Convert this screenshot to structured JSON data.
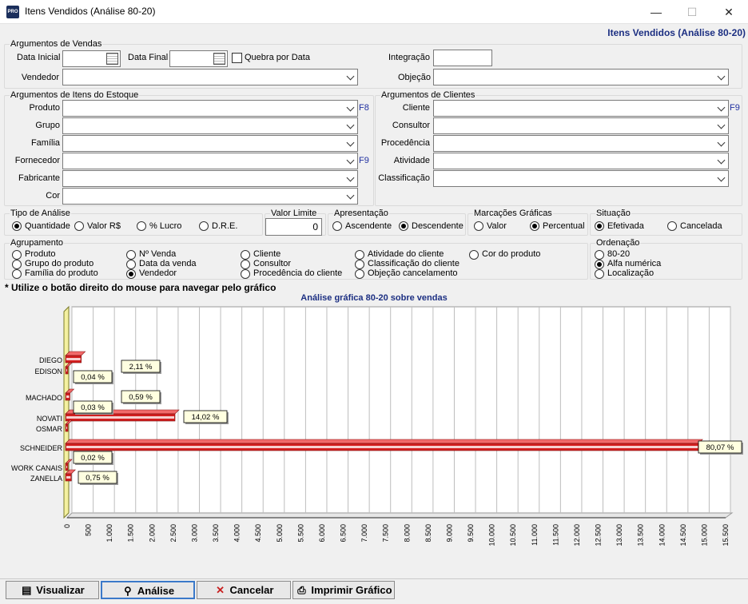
{
  "window": {
    "title": "Itens Vendidos (Análise 80-20)",
    "icon_text": "PRO",
    "minimize_glyph": "—",
    "maximize_glyph": "☐",
    "close_glyph": "✕"
  },
  "subtitle": "Itens Vendidos (Análise 80-20)",
  "vendas": {
    "legend": "Argumentos de Vendas",
    "data_inicial_label": "Data Inicial",
    "data_inicial_value": "",
    "data_final_label": "Data Final",
    "data_final_value": "",
    "quebra_label": "Quebra por Data",
    "quebra_checked": false,
    "vendedor_label": "Vendedor",
    "vendedor_value": "",
    "integracao_label": "Integração",
    "integracao_value": "",
    "objecao_label": "Objeção",
    "objecao_value": ""
  },
  "estoque": {
    "legend": "Argumentos de Itens do Estoque",
    "produto_label": "Produto",
    "produto_key": "F8",
    "grupo_label": "Grupo",
    "familia_label": "Família",
    "fornecedor_label": "Fornecedor",
    "fornecedor_key": "F9",
    "fabricante_label": "Fabricante",
    "cor_label": "Cor"
  },
  "clientes": {
    "legend": "Argumentos de Clientes",
    "cliente_label": "Cliente",
    "cliente_key": "F9",
    "consultor_label": "Consultor",
    "procedencia_label": "Procedência",
    "atividade_label": "Atividade",
    "classificacao_label": "Classificação"
  },
  "tipo_analise": {
    "legend": "Tipo de Análise",
    "options": [
      "Quantidade",
      "Valor R$",
      "% Lucro",
      "D.R.E."
    ],
    "selected": "Quantidade"
  },
  "valor_limite": {
    "legend": "Valor Limite",
    "value": "0"
  },
  "apresentacao": {
    "legend": "Apresentação",
    "options": [
      "Ascendente",
      "Descendente"
    ],
    "selected": "Descendente"
  },
  "marcacoes": {
    "legend": "Marcações Gráficas",
    "options": [
      "Valor",
      "Percentual"
    ],
    "selected": "Percentual"
  },
  "situacao": {
    "legend": "Situação",
    "options": [
      "Efetivada",
      "Cancelada"
    ],
    "selected": "Efetivada"
  },
  "agrupamento": {
    "legend": "Agrupamento",
    "options": [
      "Produto",
      "Grupo do produto",
      "Família do produto",
      "Nº Venda",
      "Data da venda",
      "Vendedor",
      "Cliente",
      "Consultor",
      "Procedência do cliente",
      "Atividade do cliente",
      "Classificação do cliente",
      "Objeção cancelamento",
      "Cor do produto"
    ],
    "selected": "Vendedor"
  },
  "ordenacao": {
    "legend": "Ordenação",
    "options": [
      "80-20",
      "Alfa numérica",
      "Localização"
    ],
    "selected": "Alfa numérica"
  },
  "note": "* Utilize o botão direito do mouse para navegar pelo gráfico",
  "chart_data": {
    "type": "bar",
    "orientation": "horizontal",
    "title": "Análise gráfica 80-20 sobre vendas",
    "categories": [
      "DIEGO",
      "EDISON",
      "MACHADO",
      "NOVATI",
      "OSMAR",
      "SCHNEIDER",
      "WORK CANAIS",
      "ZANELLA"
    ],
    "values": [
      370,
      7,
      104,
      2577,
      5,
      14900,
      3,
      137
    ],
    "labels": [
      "2,11 %",
      "0,04 %",
      "0,59 %",
      "14,02 %",
      "0,03 %",
      "80,07 %",
      "0,02 %",
      "0,75 %"
    ],
    "xlim": [
      0,
      15500
    ],
    "xticks": [
      "0",
      "500",
      "1.000",
      "1.500",
      "2.000",
      "2.500",
      "3.000",
      "3.500",
      "4.000",
      "4.500",
      "5.000",
      "5.500",
      "6.000",
      "6.500",
      "7.000",
      "7.500",
      "8.000",
      "8.500",
      "9.000",
      "9.500",
      "10.000",
      "10.500",
      "11.000",
      "11.500",
      "12.000",
      "12.500",
      "13.000",
      "13.500",
      "14.000",
      "14.500",
      "15.000",
      "15.500"
    ],
    "grid": true,
    "bar_color": "#d21f1f"
  },
  "buttons": {
    "visualizar": "Visualizar",
    "analise": "Análise",
    "cancelar": "Cancelar",
    "imprimir": "Imprimir Gráfico"
  }
}
